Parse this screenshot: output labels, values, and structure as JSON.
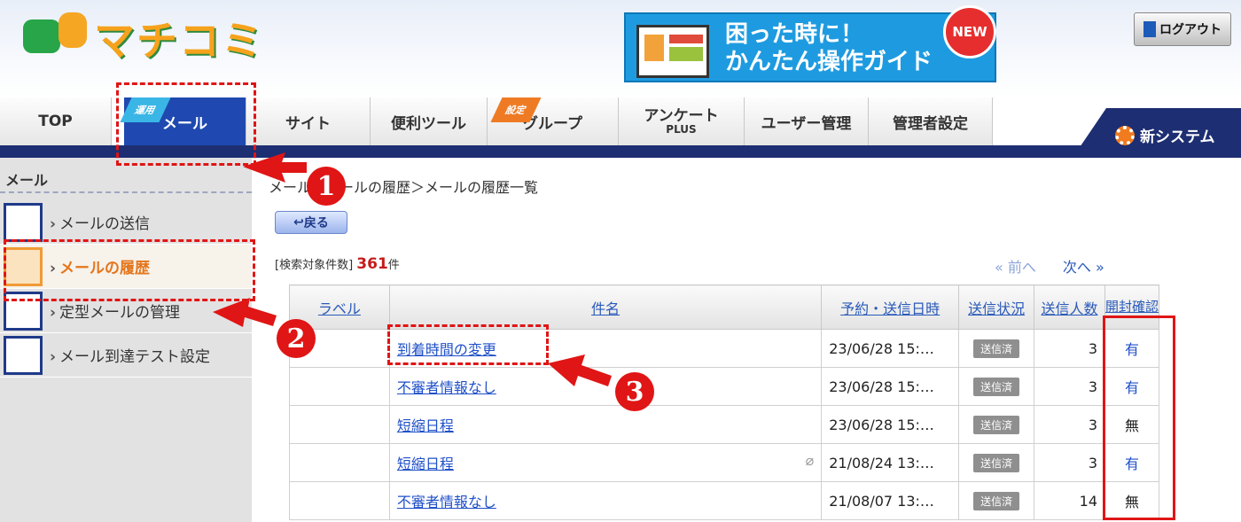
{
  "header": {
    "logo_text": "マチコミ",
    "banner_line1": "困った時に！",
    "banner_line2": "かんたん操作ガイド",
    "banner_badge": "NEW",
    "logout_label": "ログアウト"
  },
  "nav": {
    "tabs": [
      {
        "label": "TOP"
      },
      {
        "label": "メール",
        "ribbon": "運用"
      },
      {
        "label": "サイト"
      },
      {
        "label": "便利ツール"
      },
      {
        "label": "グループ",
        "ribbon": "設定"
      },
      {
        "label": "アンケート",
        "sub": "PLUS"
      },
      {
        "label": "ユーザー管理"
      },
      {
        "label": "管理者設定"
      }
    ],
    "new_system_label": "新システム"
  },
  "sidebar": {
    "title": "メール",
    "items": [
      {
        "label": "メールの送信"
      },
      {
        "label": "メールの履歴"
      },
      {
        "label": "定型メールの管理"
      },
      {
        "label": "メール到達テスト設定"
      }
    ]
  },
  "main": {
    "breadcrumb": "メール＞メールの履歴＞メールの履歴一覧",
    "back_label": "戻る",
    "count_prefix": "[検索対象件数]",
    "count_value": "361",
    "count_suffix": "件",
    "prev_label": "前へ",
    "next_label": "次へ",
    "table": {
      "headers": [
        "ラベル",
        "件名",
        "予約・送信日時",
        "送信状況",
        "送信人数",
        "開封確認"
      ],
      "rows": [
        {
          "label": "",
          "subject": "到着時間の変更",
          "date": "23/06/28 15:…",
          "status": "送信済",
          "count": "3",
          "open": "有"
        },
        {
          "label": "",
          "subject": "不審者情報なし",
          "date": "23/06/28 15:…",
          "status": "送信済",
          "count": "3",
          "open": "有"
        },
        {
          "label": "",
          "subject": "短縮日程",
          "date": "23/06/28 15:…",
          "status": "送信済",
          "count": "3",
          "open": "無"
        },
        {
          "label": "",
          "subject": "短縮日程",
          "date": "21/08/24 13:…",
          "status": "送信済",
          "count": "3",
          "open": "有"
        },
        {
          "label": "",
          "subject": "不審者情報なし",
          "date": "21/08/07 13:…",
          "status": "送信済",
          "count": "14",
          "open": "無"
        }
      ]
    }
  },
  "annotations": {
    "marker1": "1",
    "marker2": "2",
    "marker3": "3"
  },
  "colors": {
    "accent_red": "#e01515",
    "nav_blue": "#1d2e72",
    "active_tab": "#1f49b0",
    "link_blue": "#1f50c8"
  }
}
